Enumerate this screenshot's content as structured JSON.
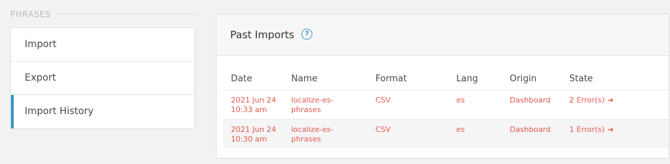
{
  "sidebar": {
    "section_label": "PHRASES",
    "items": [
      {
        "label": "Import",
        "active": false
      },
      {
        "label": "Export",
        "active": false
      },
      {
        "label": "Import History",
        "active": true
      }
    ]
  },
  "panel": {
    "title": "Past Imports",
    "help_icon": "question-circle-icon"
  },
  "table": {
    "columns": [
      "Date",
      "Name",
      "Format",
      "Lang",
      "Origin",
      "State"
    ],
    "rows": [
      {
        "date_line1": "2021 Jun 24",
        "date_line2": "10:33 am",
        "name_line1": "localize-es-",
        "name_line2": "phrases",
        "format": "CSV",
        "lang": "es",
        "origin": "Dashboard",
        "state": "2 Error(s)",
        "state_icon": "arrow-right-icon"
      },
      {
        "date_line1": "2021 Jun 24",
        "date_line2": "10:30 am",
        "name_line1": "localize-es-",
        "name_line2": "phrases",
        "format": "CSV",
        "lang": "es",
        "origin": "Dashboard",
        "state": "1 Error(s)",
        "state_icon": "arrow-right-icon"
      }
    ]
  },
  "colors": {
    "accent": "#3a93c6",
    "error_text": "#e05a4f",
    "background": "#f2f2f2"
  }
}
